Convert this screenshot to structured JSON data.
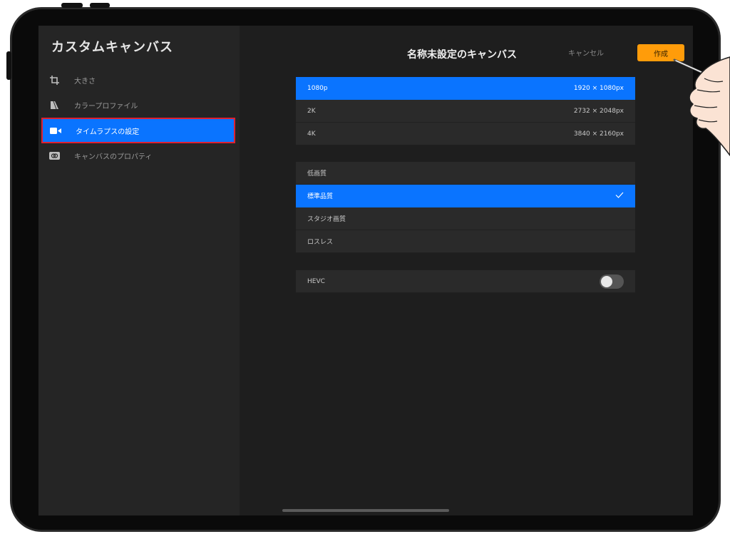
{
  "sidebar": {
    "title": "カスタムキャンバス",
    "items": [
      {
        "label": "大きさ",
        "icon": "crop-icon"
      },
      {
        "label": "カラープロファイル",
        "icon": "color-profile-icon"
      },
      {
        "label": "タイムラプスの設定",
        "icon": "video-camera-icon",
        "active": true
      },
      {
        "label": "キャンバスのプロパティ",
        "icon": "canvas-properties-icon"
      }
    ]
  },
  "header": {
    "title": "名称未設定のキャンバス",
    "cancel_label": "キャンセル",
    "create_label": "作成"
  },
  "resolution_options": [
    {
      "label": "1080p",
      "value": "1920 × 1080px",
      "selected": true
    },
    {
      "label": "2K",
      "value": "2732 × 2048px",
      "selected": false
    },
    {
      "label": "4K",
      "value": "3840 × 2160px",
      "selected": false
    }
  ],
  "quality_options": [
    {
      "label": "低画質",
      "selected": false
    },
    {
      "label": "標準品質",
      "selected": true
    },
    {
      "label": "スタジオ画質",
      "selected": false
    },
    {
      "label": "ロスレス",
      "selected": false
    }
  ],
  "hevc": {
    "label": "HEVC",
    "enabled": false
  },
  "colors": {
    "accent": "#0a74ff",
    "create_button": "#ff9c0a",
    "highlight_border": "#e02030"
  }
}
